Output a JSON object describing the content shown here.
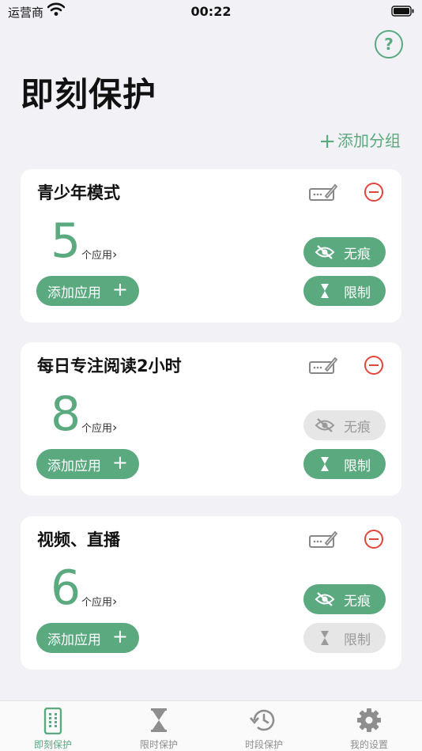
{
  "status_bar": {
    "carrier": "运营商",
    "time": "00:22"
  },
  "header": {
    "title": "即刻保护",
    "help_label": "?",
    "add_group_label": "添加分组"
  },
  "cards": [
    {
      "name": "青少年模式",
      "count": "5",
      "count_label": "个应用",
      "add_app_label": "添加应用",
      "traceless_label": "无痕",
      "limit_label": "限制",
      "traceless_on": true,
      "limit_on": true
    },
    {
      "name": "每日专注阅读2小时",
      "count": "8",
      "count_label": "个应用",
      "add_app_label": "添加应用",
      "traceless_label": "无痕",
      "limit_label": "限制",
      "traceless_on": false,
      "limit_on": true
    },
    {
      "name": "视频、直播",
      "count": "6",
      "count_label": "个应用",
      "add_app_label": "添加应用",
      "traceless_label": "无痕",
      "limit_label": "限制",
      "traceless_on": true,
      "limit_on": false
    }
  ],
  "tabs": [
    {
      "label": "即刻保护",
      "icon": "phone-icon",
      "active": true
    },
    {
      "label": "限时保护",
      "icon": "hourglass-icon",
      "active": false
    },
    {
      "label": "时段保护",
      "icon": "clock-history-icon",
      "active": false
    },
    {
      "label": "我的设置",
      "icon": "gear-icon",
      "active": false
    }
  ],
  "colors": {
    "accent": "#5aa97f",
    "danger": "#e0453a",
    "disabled": "#e6e6e6",
    "background": "#f2f2f6"
  }
}
